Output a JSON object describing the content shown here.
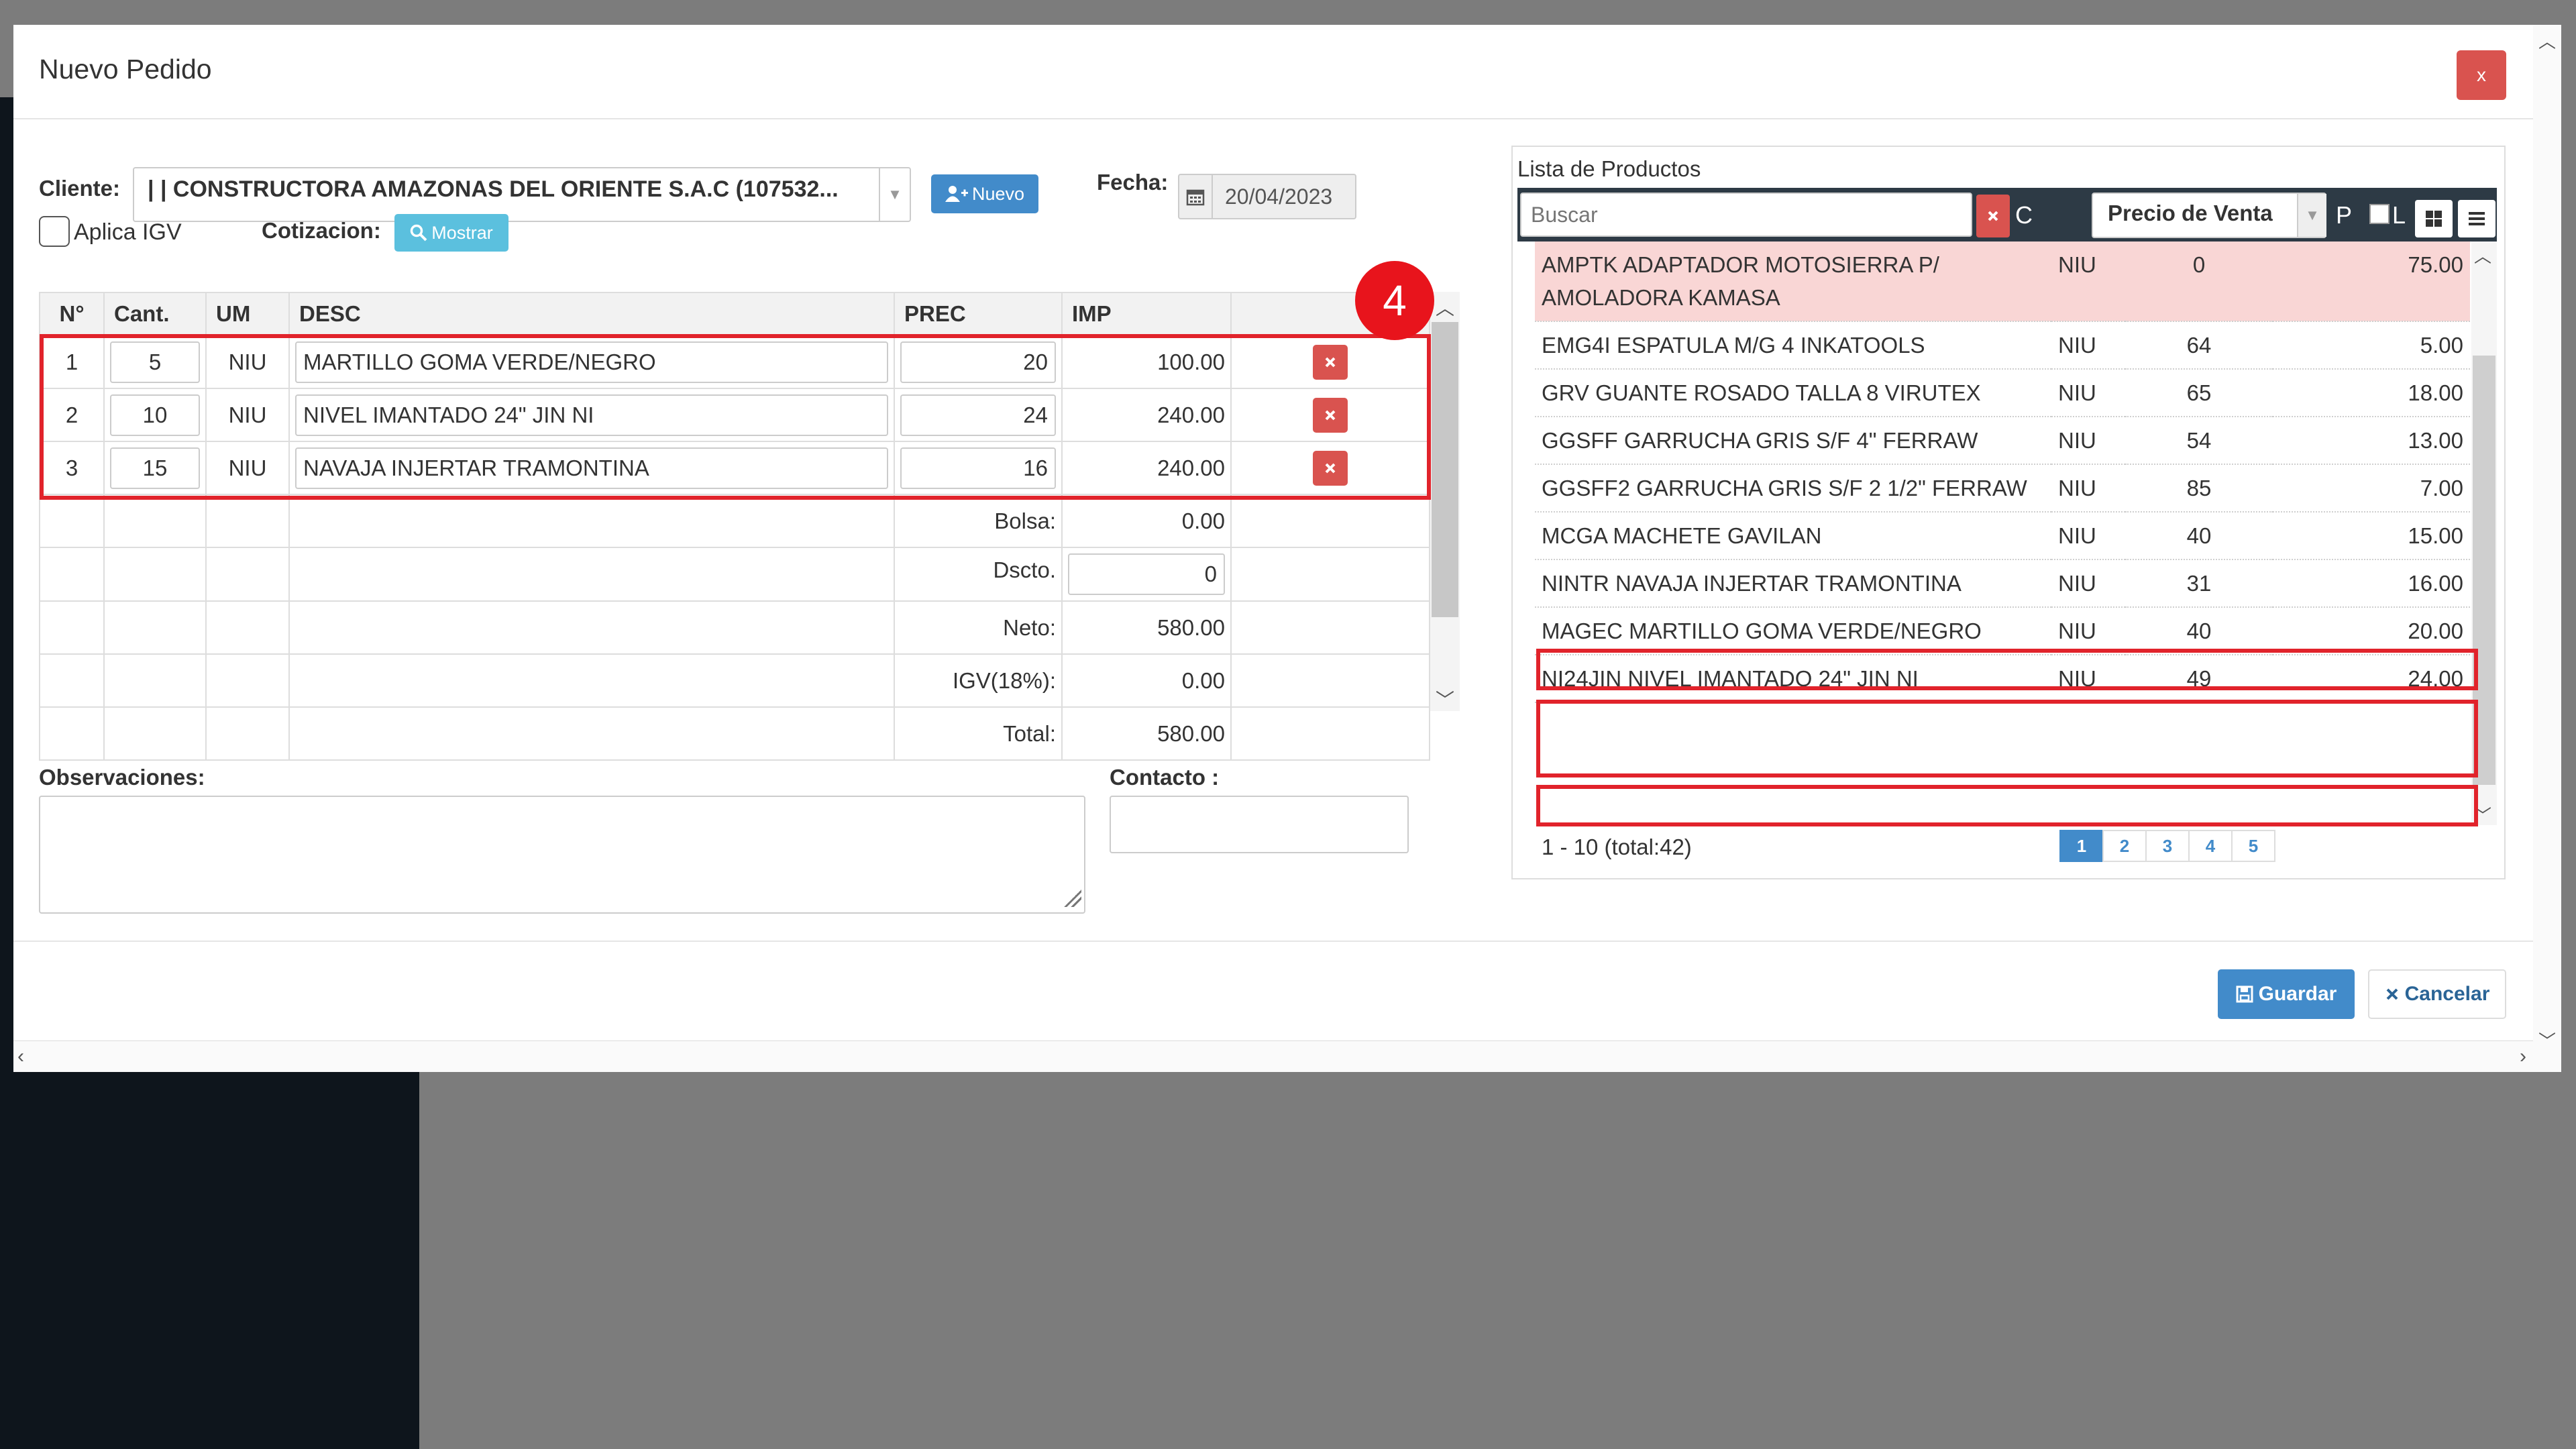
{
  "dialog": {
    "title": "Nuevo Pedido",
    "close_label": "x"
  },
  "form": {
    "cliente_label": "Cliente:",
    "cliente_value": "| | CONSTRUCTORA AMAZONAS DEL ORIENTE S.A.C (107532...",
    "nuevo_label": "Nuevo",
    "fecha_label": "Fecha:",
    "fecha_value": "20/04/2023",
    "aplica_igv_label": "Aplica IGV",
    "aplica_igv_checked": false,
    "cotizacion_label": "Cotizacion:",
    "mostrar_label": "Mostrar"
  },
  "order": {
    "headers": [
      "N°",
      "Cant.",
      "UM",
      "DESC",
      "PREC",
      "IMP",
      ""
    ],
    "rows": [
      {
        "n": "1",
        "cant": "5",
        "um": "NIU",
        "desc": "MARTILLO GOMA VERDE/NEGRO",
        "prec": "20",
        "imp": "100.00"
      },
      {
        "n": "2",
        "cant": "10",
        "um": "NIU",
        "desc": "NIVEL IMANTADO 24\" JIN NI",
        "prec": "24",
        "imp": "240.00"
      },
      {
        "n": "3",
        "cant": "15",
        "um": "NIU",
        "desc": "NAVAJA INJERTAR TRAMONTINA",
        "prec": "16",
        "imp": "240.00"
      }
    ],
    "totals": {
      "bolsa_label": "Bolsa:",
      "bolsa": "0.00",
      "dscto_label": "Dscto.",
      "dscto": "0",
      "neto_label": "Neto:",
      "neto": "580.00",
      "igv_label": "IGV(18%):",
      "igv": "0.00",
      "total_label": "Total:",
      "total": "580.00"
    }
  },
  "annotation": {
    "step_number": "4",
    "highlight_color": "#e1232b"
  },
  "observaciones_label": "Observaciones:",
  "contacto_label": "Contacto :",
  "products": {
    "title": "Lista de Productos",
    "search_placeholder": "Buscar",
    "clear_letter": "C",
    "price_select": "Precio de Venta",
    "p_label": "P",
    "l_label": "L",
    "rows": [
      {
        "desc": "AMPTK ADAPTADOR MOTOSIERRA P/ AMOLADORA KAMASA",
        "um": "NIU",
        "stock": "0",
        "price": "75.00",
        "zero_stock": true
      },
      {
        "desc": "EMG4I ESPATULA M/G 4 INKATOOLS",
        "um": "NIU",
        "stock": "64",
        "price": "5.00"
      },
      {
        "desc": "GRV GUANTE ROSADO TALLA 8 VIRUTEX",
        "um": "NIU",
        "stock": "65",
        "price": "18.00"
      },
      {
        "desc": "GGSFF GARRUCHA GRIS S/F 4\" FERRAW",
        "um": "NIU",
        "stock": "54",
        "price": "13.00"
      },
      {
        "desc": "GGSFF2 GARRUCHA GRIS S/F 2 1/2\" FERRAW",
        "um": "NIU",
        "stock": "85",
        "price": "7.00"
      },
      {
        "desc": "MCGA MACHETE GAVILAN",
        "um": "NIU",
        "stock": "40",
        "price": "15.00"
      },
      {
        "desc": "NINTR NAVAJA INJERTAR TRAMONTINA",
        "um": "NIU",
        "stock": "31",
        "price": "16.00",
        "highlighted": true
      },
      {
        "desc": "MAGEC MARTILLO GOMA VERDE/NEGRO",
        "um": "NIU",
        "stock": "40",
        "price": "20.00",
        "highlighted": true
      },
      {
        "desc": "NI24JIN NIVEL IMANTADO 24\" JIN NI",
        "um": "NIU",
        "stock": "49",
        "price": "24.00",
        "highlighted": true
      }
    ],
    "range_text": "1 - 10 (total:42)",
    "pages": [
      "1",
      "2",
      "3",
      "4",
      "5"
    ],
    "active_page": "1"
  },
  "footer": {
    "guardar_label": "Guardar",
    "cancelar_label": "Cancelar"
  },
  "colors": {
    "danger": "#d9534f",
    "primary": "#428bca",
    "info": "#5bc0de",
    "zero_stock_row": "#f9d6d5"
  }
}
